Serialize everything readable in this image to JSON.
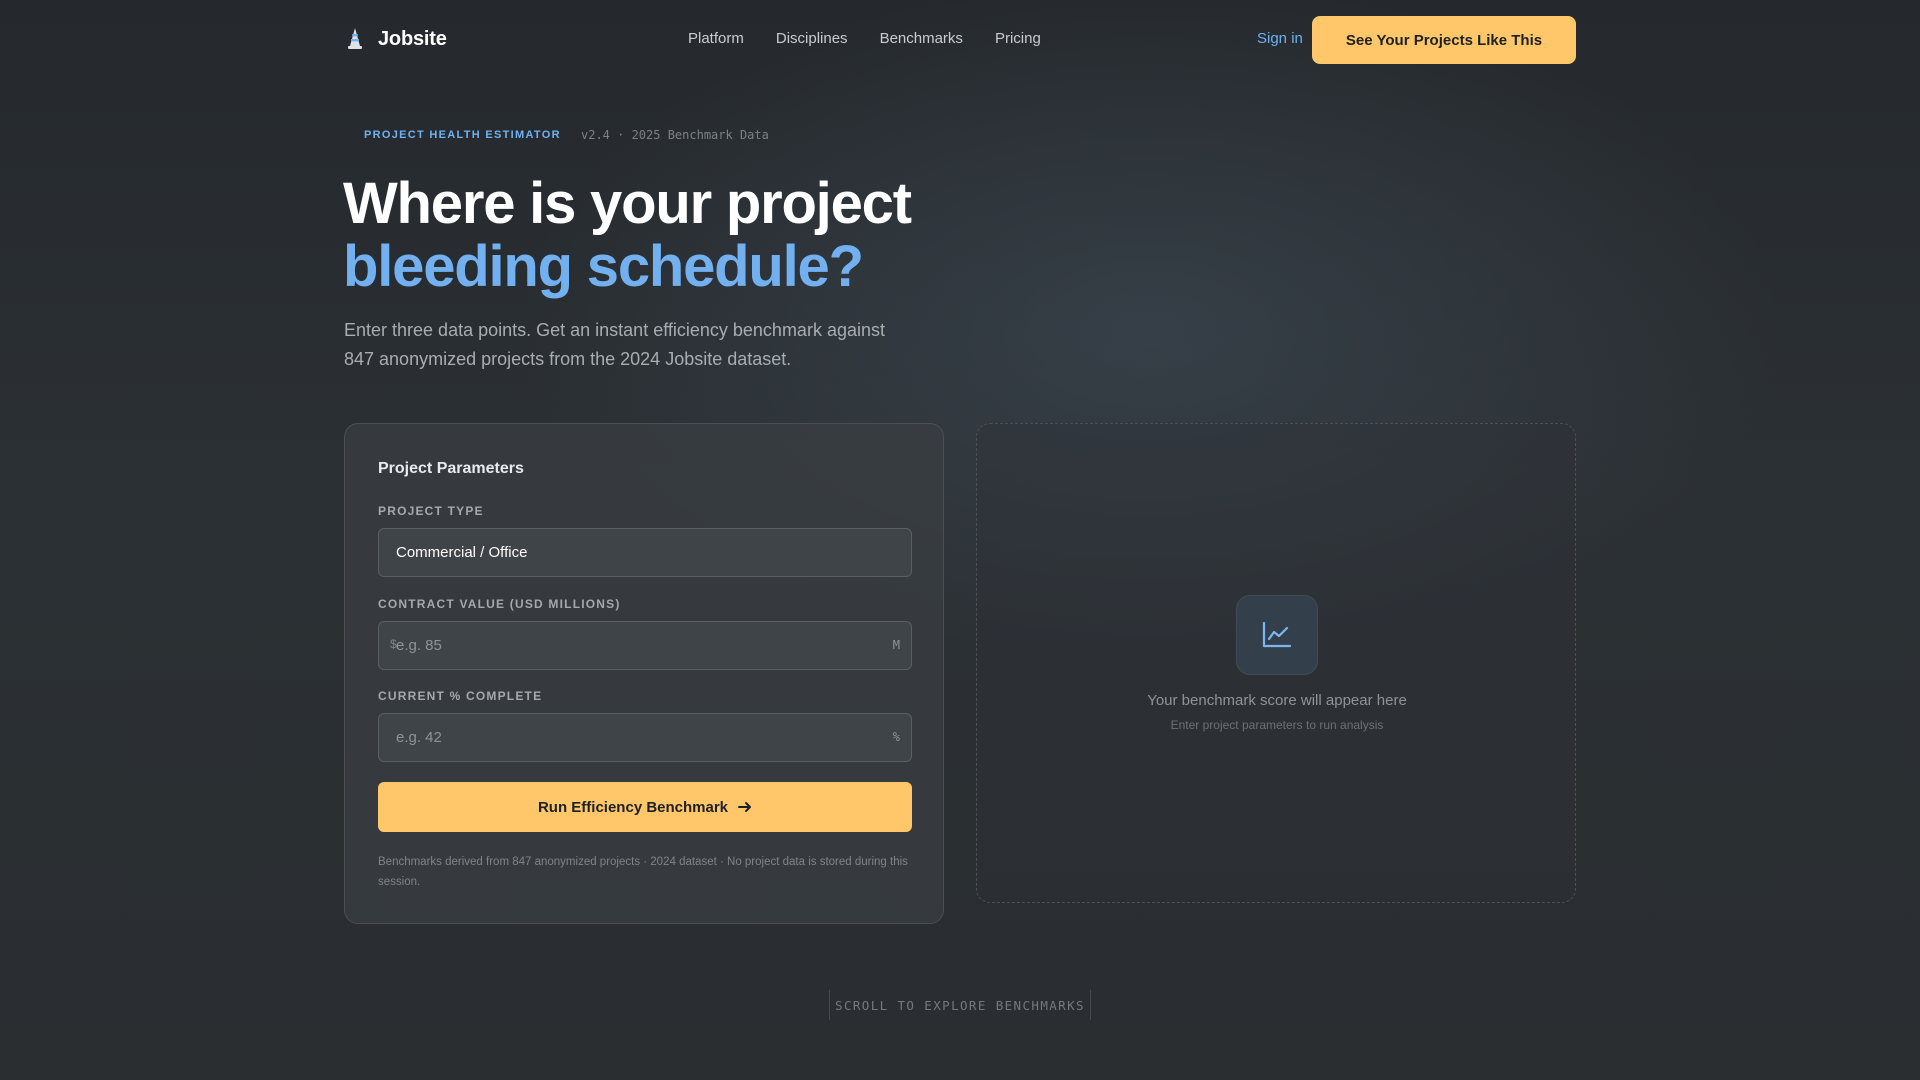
{
  "brand": {
    "name": "Jobsite",
    "logo_icon": "cone-icon"
  },
  "nav": {
    "links": [
      "Platform",
      "Disciplines",
      "Benchmarks",
      "Pricing"
    ],
    "signin": "Sign in",
    "cta": "See Your Projects Like This"
  },
  "hero": {
    "eyebrow": "PROJECT HEALTH ESTIMATOR",
    "version": "v2.4 · 2025 Benchmark Data",
    "title_line1": "Where is your project",
    "title_line2": "bleeding schedule?",
    "subtitle": "Enter three data points. Get an instant efficiency benchmark against 847 anonymized projects from the 2024 Jobsite dataset."
  },
  "form": {
    "title": "Project Parameters",
    "project_type": {
      "label": "PROJECT TYPE",
      "value": "Commercial / Office"
    },
    "contract_value": {
      "label": "CONTRACT VALUE (USD MILLIONS)",
      "prefix": "$",
      "placeholder": "e.g. 85",
      "suffix": "M"
    },
    "percent_complete": {
      "label": "CURRENT % COMPLETE",
      "placeholder": "e.g. 42",
      "suffix": "%"
    },
    "submit": "Run Efficiency Benchmark",
    "submit_icon": "arrow-right-icon",
    "note": "Benchmarks derived from 847 anonymized projects · 2024 dataset · No project data is stored during this session."
  },
  "result": {
    "icon": "line-chart-icon",
    "message": "Your benchmark score will appear here",
    "hint": "Enter project parameters to run analysis"
  },
  "scroll_hint": "SCROLL TO EXPLORE BENCHMARKS",
  "colors": {
    "accent_blue": "#72b0f0",
    "accent_amber": "#ffc76a",
    "background": "#2a2e31"
  }
}
